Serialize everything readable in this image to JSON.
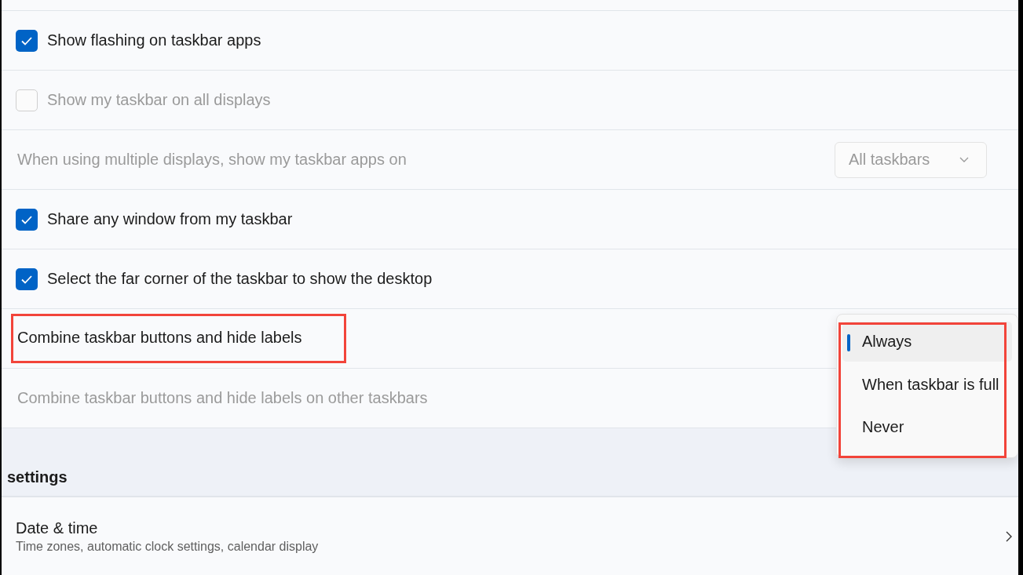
{
  "rows": [
    {
      "kind": "checkbox",
      "label": "Show flashing on taskbar apps",
      "checked": true,
      "disabled": false
    },
    {
      "kind": "checkbox",
      "label": "Show my taskbar on all displays",
      "checked": false,
      "disabled": true
    },
    {
      "kind": "dropdown",
      "label": "When using multiple displays, show my taskbar apps on",
      "value": "All taskbars",
      "disabled": true
    },
    {
      "kind": "checkbox",
      "label": "Share any window from my taskbar",
      "checked": true,
      "disabled": false
    },
    {
      "kind": "checkbox",
      "label": "Select the far corner of the taskbar to show the desktop",
      "checked": true,
      "disabled": false
    },
    {
      "kind": "label",
      "label": "Combine taskbar buttons and hide labels",
      "disabled": false,
      "highlighted": true
    },
    {
      "kind": "label",
      "label": "Combine taskbar buttons and hide labels on other taskbars",
      "disabled": true,
      "highlighted": false
    }
  ],
  "menu": {
    "highlighted": true,
    "items": [
      {
        "label": "Always",
        "selected": true
      },
      {
        "label": "When taskbar is full",
        "selected": false
      },
      {
        "label": "Never",
        "selected": false
      }
    ]
  },
  "section": {
    "title": "settings"
  },
  "link_row": {
    "title": "Date & time",
    "subtitle": "Time zones, automatic clock settings, calendar display"
  }
}
